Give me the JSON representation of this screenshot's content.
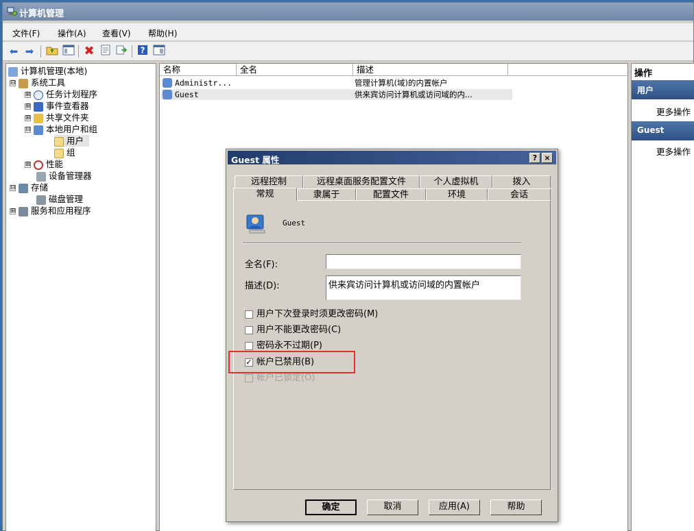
{
  "window": {
    "title": "计算机管理"
  },
  "menu": [
    "文件(F)",
    "操作(A)",
    "查看(V)",
    "帮助(H)"
  ],
  "toolbar_icons": [
    "back-arrow-icon",
    "forward-arrow-icon",
    "up-folder-icon",
    "show-hide-tree-icon",
    "delete-icon",
    "properties-icon",
    "export-icon",
    "help-icon",
    "view-icon"
  ],
  "tree": {
    "root": "计算机管理(本地)",
    "system_tools": "系统工具",
    "task_scheduler": "任务计划程序",
    "event_viewer": "事件查看器",
    "shared_folders": "共享文件夹",
    "local_users": "本地用户和组",
    "users": "用户",
    "groups": "组",
    "performance": "性能",
    "device_manager": "设备管理器",
    "storage": "存储",
    "disk_management": "磁盘管理",
    "services": "服务和应用程序",
    "expand": "⊞",
    "collapse": "⊟"
  },
  "list": {
    "columns": [
      "名称",
      "全名",
      "描述"
    ],
    "rows": [
      {
        "name": "Administr...",
        "fullname": "",
        "desc": "管理计算机(域)的内置帐户"
      },
      {
        "name": "Guest",
        "fullname": "",
        "desc": "供来宾访问计算机或访问域的内..."
      }
    ]
  },
  "actions": {
    "header": "操作",
    "section1": "用户",
    "more1": "更多操作",
    "section2": "Guest",
    "more2": "更多操作"
  },
  "dialog": {
    "title": "Guest 属性",
    "help_btn": "?",
    "close_btn": "×",
    "tabs_row1": [
      "远程控制",
      "远程桌面服务配置文件",
      "个人虚拟机",
      "拨入"
    ],
    "tabs_row2": [
      "常规",
      "隶属于",
      "配置文件",
      "环境",
      "会话"
    ],
    "user_name": "Guest",
    "fullname_label": "全名(F):",
    "fullname_value": "",
    "desc_label": "描述(D):",
    "desc_value": "供来宾访问计算机或访问域的内置帐户",
    "checkboxes": [
      {
        "label": "用户下次登录时须更改密码(M)",
        "checked": false,
        "enabled": true,
        "mark": ""
      },
      {
        "label": "用户不能更改密码(C)",
        "checked": false,
        "enabled": true,
        "mark": ""
      },
      {
        "label": "密码永不过期(P)",
        "checked": false,
        "enabled": true,
        "mark": ""
      },
      {
        "label": "帐户已禁用(B)",
        "checked": true,
        "enabled": true,
        "mark": "✓"
      },
      {
        "label": "帐户已锁定(O)",
        "checked": false,
        "enabled": false,
        "mark": ""
      }
    ],
    "buttons": [
      "确定",
      "取消",
      "应用(A)",
      "帮助"
    ]
  },
  "colors": {
    "highlight": "#e03030",
    "title_active": "#213c6b",
    "action_header": "#2d5184"
  }
}
